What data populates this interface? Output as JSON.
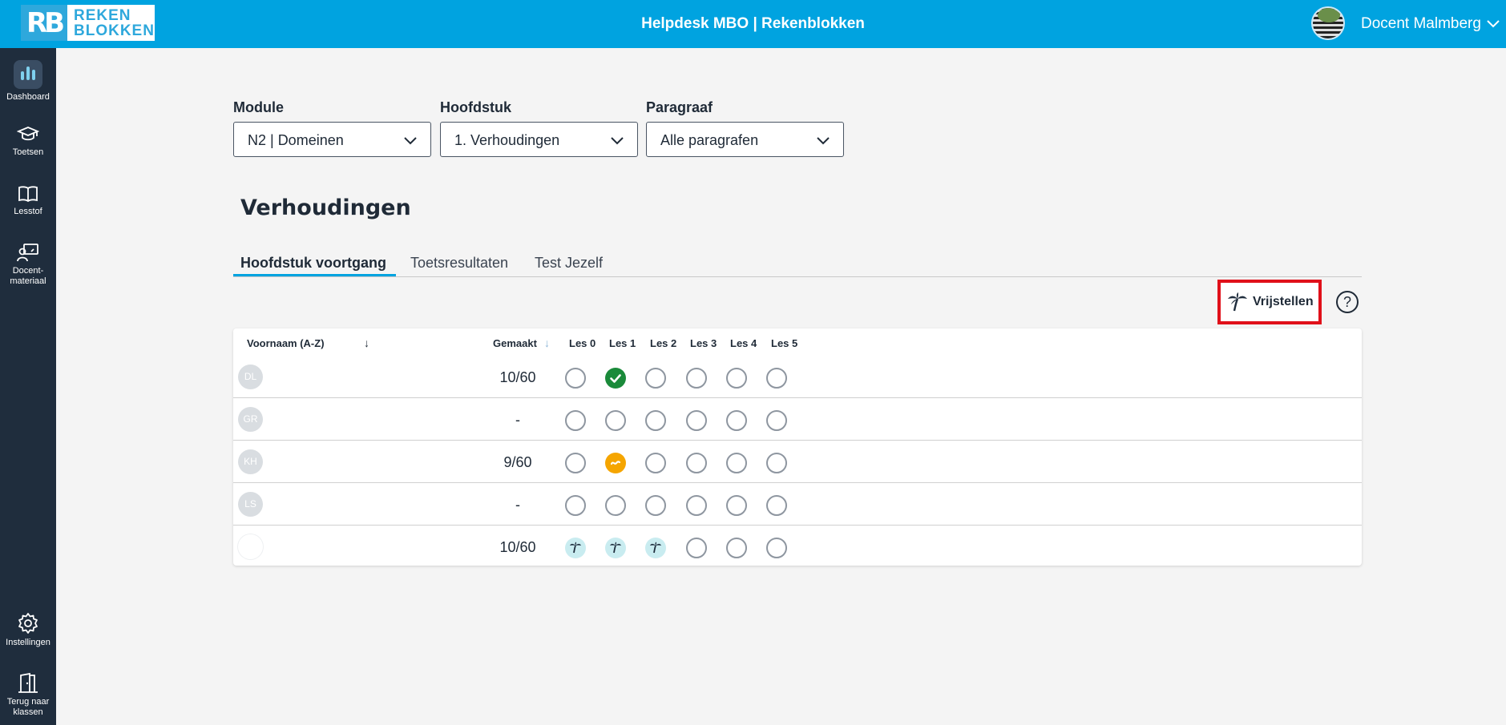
{
  "topbar": {
    "logo_mark": "RB",
    "logo_line1": "REKEN",
    "logo_line2": "BLOKKEN",
    "title": "Helpdesk MBO | Rekenblokken",
    "user_name": "Docent Malmberg"
  },
  "sidebar": {
    "items": [
      {
        "label": "Dashboard",
        "icon": "bar-chart-icon"
      },
      {
        "label": "Toetsen",
        "icon": "graduation-cap-icon"
      },
      {
        "label": "Lesstof",
        "icon": "book-icon"
      },
      {
        "label_line1": "Docent-",
        "label_line2": "materiaal",
        "icon": "teacher-board-icon"
      },
      {
        "label": "Instellingen",
        "icon": "gear-icon"
      },
      {
        "label_line1": "Terug naar",
        "label_line2": "klassen",
        "icon": "door-icon"
      }
    ]
  },
  "filters": {
    "module": {
      "label": "Module",
      "value": "N2 | Domeinen"
    },
    "hoofdstuk": {
      "label": "Hoofdstuk",
      "value": "1. Verhoudingen"
    },
    "paragraaf": {
      "label": "Paragraaf",
      "value": "Alle paragrafen"
    }
  },
  "chapter_title": "Verhoudingen",
  "tabs": [
    {
      "label": "Hoofdstuk voortgang",
      "active": true
    },
    {
      "label": "Toetsresultaten",
      "active": false
    },
    {
      "label": "Test Jezelf",
      "active": false
    }
  ],
  "actions": {
    "vrijstellen_label": "Vrijstellen",
    "help_label": "?"
  },
  "table": {
    "col_name": "Voornaam (A-Z)",
    "name_sort_arrow": "↓",
    "col_made": "Gemaakt",
    "made_sort_arrow": "↓",
    "lessons": [
      "Les 0",
      "Les 1",
      "Les 2",
      "Les 3",
      "Les 4",
      "Les 5"
    ],
    "rows": [
      {
        "initials": "DL",
        "made": "10/60",
        "status": [
          "empty",
          "done",
          "empty",
          "empty",
          "empty",
          "empty"
        ]
      },
      {
        "initials": "GR",
        "made": "-",
        "status": [
          "empty",
          "empty",
          "empty",
          "empty",
          "empty",
          "empty"
        ]
      },
      {
        "initials": "KH",
        "made": "9/60",
        "status": [
          "empty",
          "partial",
          "empty",
          "empty",
          "empty",
          "empty"
        ]
      },
      {
        "initials": "LS",
        "made": "-",
        "status": [
          "empty",
          "empty",
          "empty",
          "empty",
          "empty",
          "empty"
        ]
      },
      {
        "initials": "",
        "made": "10/60",
        "status": [
          "exempt",
          "exempt",
          "exempt",
          "empty",
          "empty",
          "empty"
        ]
      }
    ]
  },
  "colors": {
    "topbar": "#00a3e0",
    "sidebar": "#1f2d3d",
    "done": "#1a8a3a",
    "partial": "#f5a500",
    "exempt": "#c9ecf0",
    "highlight": "#e0101a"
  }
}
